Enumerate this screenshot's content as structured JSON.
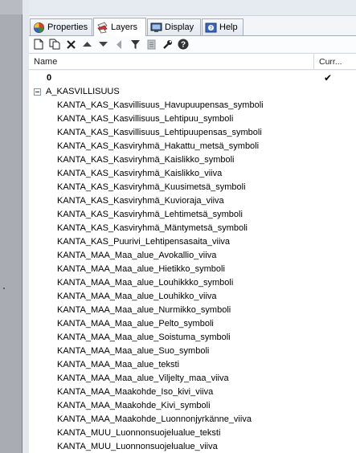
{
  "tabs": [
    {
      "label": "Properties",
      "icon": "properties-icon"
    },
    {
      "label": "Layers",
      "icon": "layers-icon"
    },
    {
      "label": "Display",
      "icon": "display-icon"
    },
    {
      "label": "Help",
      "icon": "help-icon"
    }
  ],
  "active_tab": "Layers",
  "toolbar": [
    "new-layer-icon",
    "new-sublayer-icon",
    "delete-icon",
    "move-up-icon",
    "move-down-icon",
    "move-left-icon",
    "filter-icon",
    "layer-tools-icon",
    "wrench-icon",
    "help-question-icon"
  ],
  "columns": {
    "name": "Name",
    "current": "Curr..."
  },
  "check_mark": "✔",
  "root_layer": "0",
  "group_layer": "A_KASVILLISUUS",
  "layers": [
    "KANTA_KAS_Kasvillisuus_Havupuupensas_symboli",
    "KANTA_KAS_Kasvillisuus_Lehtipuu_symboli",
    "KANTA_KAS_Kasvillisuus_Lehtipuupensas_symboli",
    "KANTA_KAS_Kasviryhmä_Hakattu_metsä_symboli",
    "KANTA_KAS_Kasviryhmä_Kaislikko_symboli",
    "KANTA_KAS_Kasviryhmä_Kaislikko_viiva",
    "KANTA_KAS_Kasviryhmä_Kuusimetsä_symboli",
    "KANTA_KAS_Kasviryhmä_Kuvioraja_viiva",
    "KANTA_KAS_Kasviryhmä_Lehtimetsä_symboli",
    "KANTA_KAS_Kasviryhmä_Mäntymetsä_symboli",
    "KANTA_KAS_Puurivi_Lehtipensasaita_viiva",
    "KANTA_MAA_Maa_alue_Avokallio_viiva",
    "KANTA_MAA_Maa_alue_Hietikko_symboli",
    "KANTA_MAA_Maa_alue_Louhikkko_symboli",
    "KANTA_MAA_Maa_alue_Louhikko_viiva",
    "KANTA_MAA_Maa_alue_Nurmikko_symboli",
    "KANTA_MAA_Maa_alue_Pelto_symboli",
    "KANTA_MAA_Maa_alue_Soistuma_symboli",
    "KANTA_MAA_Maa_alue_Suo_symboli",
    "KANTA_MAA_Maa_alue_teksti",
    "KANTA_MAA_Maa_alue_Viljelty_maa_viiva",
    "KANTA_MAA_Maakohde_Iso_kivi_viiva",
    "KANTA_MAA_Maakohde_Kivi_symboli",
    "KANTA_MAA_Maakohde_Luonnonjyrkänne_viiva",
    "KANTA_MUU_Luonnonsuojelualue_teksti",
    "KANTA_MUU_Luonnonsuojelualue_viiva"
  ]
}
